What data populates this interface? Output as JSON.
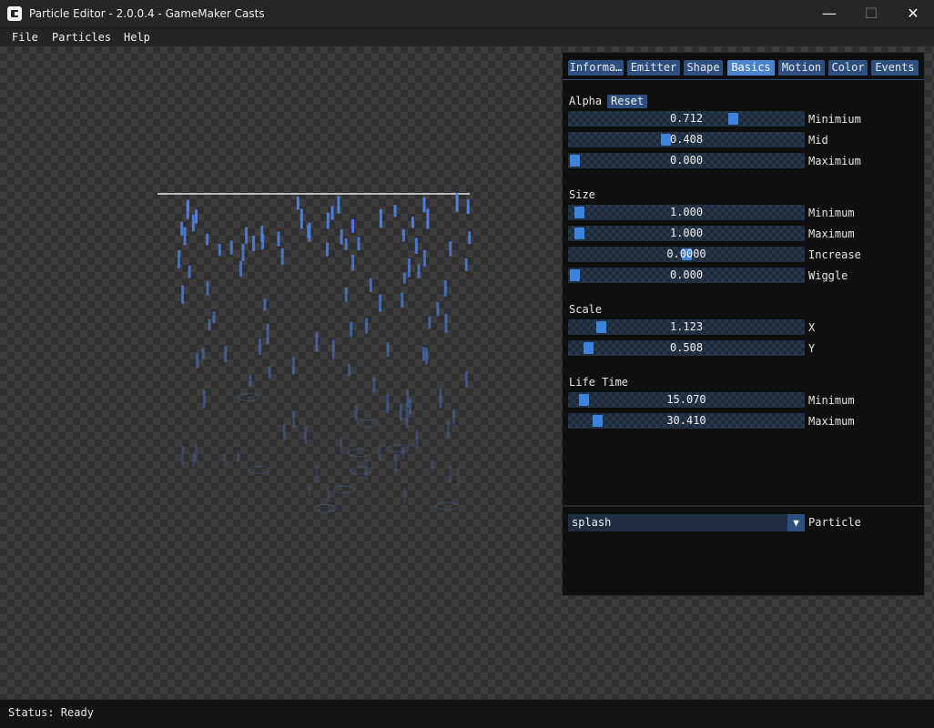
{
  "window": {
    "title": "Particle Editor - 2.0.0.4 - GameMaker Casts",
    "minimize_glyph": "—",
    "maximize_glyph": "☐",
    "close_glyph": "✕"
  },
  "menu": [
    "File",
    "Particles",
    "Help"
  ],
  "tabs": [
    {
      "label": "Informa…",
      "active": false
    },
    {
      "label": "Emitter",
      "active": false
    },
    {
      "label": "Shape",
      "active": false
    },
    {
      "label": "Basics",
      "active": true
    },
    {
      "label": "Motion",
      "active": false
    },
    {
      "label": "Color",
      "active": false
    },
    {
      "label": "Events",
      "active": false
    }
  ],
  "alpha": {
    "title": "Alpha",
    "reset_label": "Reset",
    "rows": [
      {
        "value": "0.712",
        "label": "Minimium",
        "level": 0.712
      },
      {
        "value": "0.408",
        "label": "Mid",
        "level": 0.408
      },
      {
        "value": "0.000",
        "label": "Maximium",
        "level": 0.0
      }
    ]
  },
  "size": {
    "title": "Size",
    "rows": [
      {
        "value": "1.000",
        "label": "Minimum",
        "level": 0.02
      },
      {
        "value": "1.000",
        "label": "Maximum",
        "level": 0.02
      },
      {
        "value": "0.0000",
        "label": "Increase",
        "level": 0.5
      },
      {
        "value": "0.000",
        "label": "Wiggle",
        "level": 0.0
      }
    ]
  },
  "scale": {
    "title": "Scale",
    "rows": [
      {
        "value": "1.123",
        "label": "X",
        "level": 0.12
      },
      {
        "value": "0.508",
        "label": "Y",
        "level": 0.06
      }
    ]
  },
  "lifetime": {
    "title": "Life Time",
    "rows": [
      {
        "value": "15.070",
        "label": "Minimum",
        "level": 0.04
      },
      {
        "value": "30.410",
        "label": "Maximum",
        "level": 0.1
      }
    ]
  },
  "particle_select": {
    "value": "splash",
    "label": "Particle",
    "arrow_glyph": "▼"
  },
  "status": "Status: Ready",
  "colors": {
    "particle": "#4f7fe0",
    "tab_active": "#4a84cf",
    "tab": "#2d4f7f",
    "handle": "#3d82dc"
  }
}
